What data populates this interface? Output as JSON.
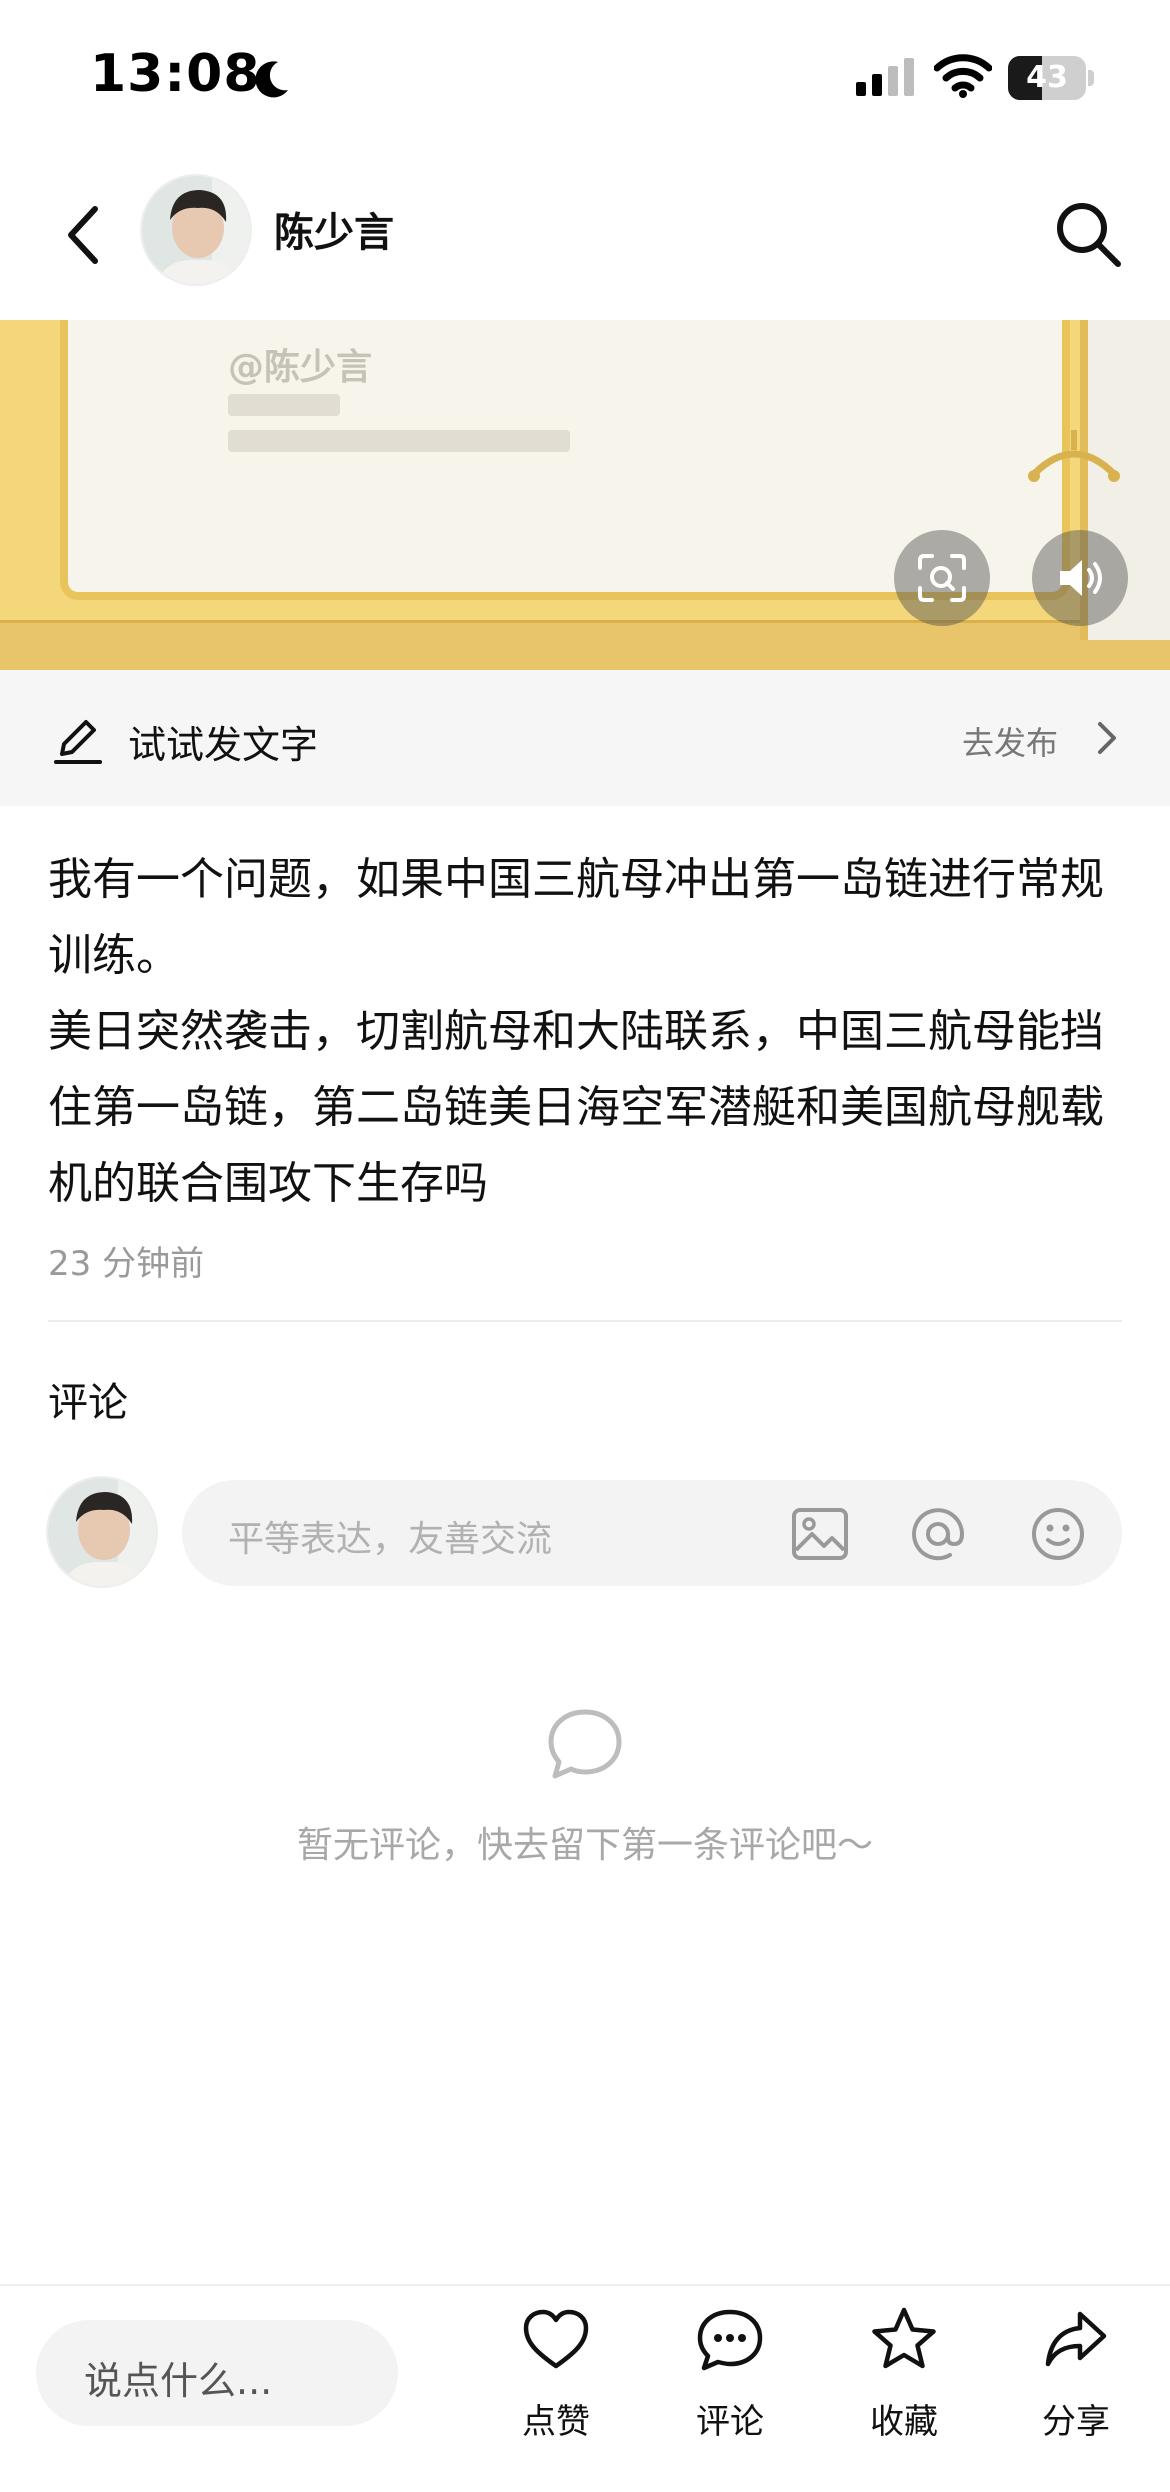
{
  "status_bar": {
    "time": "13:08",
    "battery_level": "43",
    "battery_fraction": 0.43,
    "icons": [
      "moon-icon",
      "signal-icon",
      "wifi-icon",
      "battery-icon"
    ]
  },
  "header": {
    "user_name": "陈少言",
    "icons": [
      "back-icon",
      "avatar",
      "search-icon"
    ]
  },
  "banner": {
    "watermark": "@陈少言",
    "colors": {
      "frame": "#f4d77a",
      "paper": "#f7f4ec"
    },
    "icons": [
      "scan-icon",
      "speaker-icon"
    ]
  },
  "compose": {
    "label": "试试发文字",
    "publish": "去发布",
    "icons": [
      "pen-icon",
      "chevron-right-icon"
    ]
  },
  "post": {
    "text": "我有一个问题，如果中国三航母冲出第一岛链进行常规训练。\n美日突然袭击，切割航母和大陆联系，中国三航母能挡住第一岛链，第二岛链美日海空军潜艇和美国航母舰载机的联合围攻下生存吗",
    "time": "23 分钟前"
  },
  "comments": {
    "title": "评论",
    "placeholder": "平等表达，友善交流",
    "empty_text": "暂无评论，快去留下第一条评论吧～",
    "icons": [
      "image-icon",
      "at-icon",
      "emoji-icon",
      "chat-bubble-icon"
    ]
  },
  "bottom_bar": {
    "input_placeholder": "说点什么...",
    "actions": [
      {
        "label": "点赞",
        "icon": "heart-icon"
      },
      {
        "label": "评论",
        "icon": "comment-icon"
      },
      {
        "label": "收藏",
        "icon": "star-icon"
      },
      {
        "label": "分享",
        "icon": "share-icon"
      }
    ]
  }
}
